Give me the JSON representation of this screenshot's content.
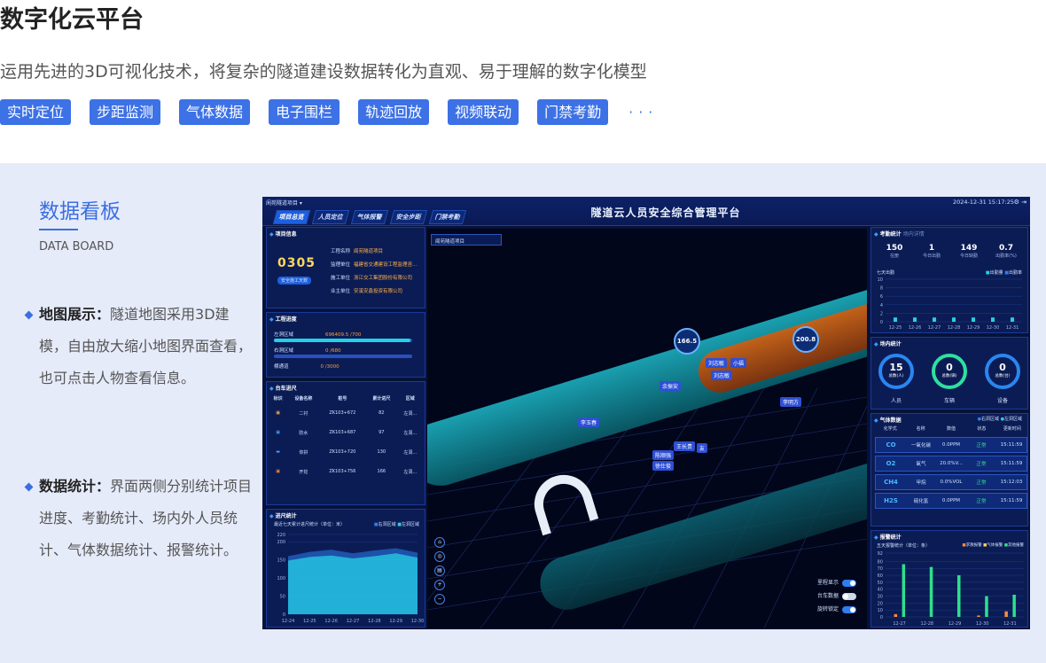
{
  "hero": {
    "title": "数字化云平台",
    "subtitle": "运用先进的3D可视化技术，将复杂的隧道建设数据转化为直观、易于理解的数字化模型",
    "tags": [
      "实时定位",
      "步距监测",
      "气体数据",
      "电子围栏",
      "轨迹回放",
      "视频联动",
      "门禁考勤"
    ],
    "more": "···"
  },
  "board": {
    "title": "数据看板",
    "subtitle": "DATA BOARD",
    "features": [
      {
        "label": "地图展示：",
        "text": "隧道地图采用3D建模，自由放大缩小地图界面查看，也可点击人物查看信息。"
      },
      {
        "label": "数据统计：",
        "text": "界面两侧分别统计项目进度、考勤统计、场内外人员统计、气体数据统计、报警统计。"
      }
    ]
  },
  "dash": {
    "project_selector": "阆苑隧道项目 ▾",
    "datetime": "2024-12-31 15:17:25",
    "title": "隧道云人员安全综合管理平台",
    "nav": [
      "项目总览",
      "人员定位",
      "气体报警",
      "安全步距",
      "门禁考勤"
    ],
    "project_info": {
      "header": "项目信息",
      "days": "0305",
      "days_label": "安全施工天数",
      "rows": [
        {
          "k": "工程名称",
          "v": "阆苑隧道项目"
        },
        {
          "k": "监理单位",
          "v": "福建省交通建设工程监理咨..."
        },
        {
          "k": "施工单位",
          "v": "浙江交工集团股份有限公司"
        },
        {
          "k": "业主单位",
          "v": "安溪安鑫投资有限公司"
        }
      ]
    },
    "progress": {
      "header": "工程进度",
      "rows": [
        {
          "name": "左洞区域",
          "value": "696409.5 /700",
          "fraction": 0.99
        },
        {
          "name": "右洞区域",
          "value": "0 /680",
          "fraction": 0
        },
        {
          "name": "横通道",
          "value": "0 /3000",
          "fraction": 0
        }
      ]
    },
    "trolley": {
      "header": "台车进尺",
      "columns": [
        "标识",
        "设备名称",
        "桩号",
        "累计进尺",
        "区域"
      ],
      "rows": [
        [
          "",
          "二衬",
          "ZK103+672",
          "82",
          "左洞..."
        ],
        [
          "",
          "防水",
          "ZK103+687",
          "97",
          "左洞..."
        ],
        [
          "",
          "仰拱",
          "ZK103+720",
          "130",
          "左洞..."
        ],
        [
          "",
          "开挖",
          "ZK103+756",
          "166",
          "左洞..."
        ]
      ]
    },
    "footage": {
      "header": "进尺统计",
      "caption": "最近七天累计进尺统计（单位：米）",
      "legend": [
        "右洞区域",
        "左洞区域"
      ],
      "chart_data": {
        "type": "area",
        "categories": [
          "12-24",
          "12-25",
          "12-26",
          "12-27",
          "12-28",
          "12-29",
          "12-30"
        ],
        "series": [
          {
            "name": "左洞区域",
            "values": [
              160,
              172,
              178,
              168,
              176,
              182,
              170
            ]
          },
          {
            "name": "右洞区域",
            "values": [
              148,
              158,
              162,
              154,
              160,
              168,
              156
            ]
          }
        ],
        "yticks": [
          0,
          50,
          100,
          150,
          200,
          220
        ],
        "ylim": [
          0,
          220
        ]
      }
    },
    "viewport": {
      "selector": "阆苑隧道项目",
      "bubbles": [
        "166.5",
        "200.8"
      ],
      "people": [
        "刘志敏",
        "小福",
        "刘志敏",
        "余振安",
        "李玉春",
        "李明方",
        "王长贵",
        "陈顺强",
        "徐仕俊",
        "友"
      ],
      "toggles": [
        {
          "label": "里程显示",
          "on": true
        },
        {
          "label": "台车数据",
          "on": false
        },
        {
          "label": "旋转锁定",
          "on": true
        }
      ],
      "controls": [
        "⌂",
        "◎",
        "▤",
        "+",
        "−"
      ]
    },
    "attendance": {
      "header": "考勤统计",
      "tab2": "场内详情",
      "stats": [
        {
          "value": "150",
          "label": "在册"
        },
        {
          "value": "1",
          "label": "今日出勤"
        },
        {
          "value": "149",
          "label": "今日缺勤"
        },
        {
          "value": "0.7",
          "label": "出勤率(%)"
        }
      ],
      "chart_label": "七天出勤",
      "legend": [
        "出勤量",
        "出勤率"
      ],
      "chart_data": {
        "type": "bar",
        "categories": [
          "12-25",
          "12-26",
          "12-27",
          "12-28",
          "12-29",
          "12-30",
          "12-31"
        ],
        "values": [
          1,
          1,
          1,
          1,
          1,
          1,
          1
        ],
        "yticks": [
          0,
          2,
          4,
          6,
          8,
          10
        ],
        "ylim": [
          0,
          10
        ]
      }
    },
    "onsite": {
      "header": "场内统计",
      "rings": [
        {
          "value": "15",
          "sub": "总数(人)",
          "label": "人员"
        },
        {
          "value": "0",
          "sub": "总数(辆)",
          "label": "车辆"
        },
        {
          "value": "0",
          "sub": "总数(台)",
          "label": "设备"
        }
      ]
    },
    "gas": {
      "header": "气体数据",
      "legend": [
        "右洞区域",
        "左洞区域"
      ],
      "columns": [
        "化学式",
        "名称",
        "数值",
        "状态",
        "更新时间"
      ],
      "rows": [
        {
          "code": "CO",
          "name": "一氧化碳",
          "value": "0.0PPM",
          "status": "正常",
          "time": "15:11:59"
        },
        {
          "code": "O2",
          "name": "氧气",
          "value": "20.0%V...",
          "status": "正常",
          "time": "15:11:59"
        },
        {
          "code": "CH4",
          "name": "甲烷",
          "value": "0.0%VOL",
          "status": "正常",
          "time": "15:12:03"
        },
        {
          "code": "H2S",
          "name": "硫化氢",
          "value": "0.0PPM",
          "status": "正常",
          "time": "15:11:59"
        }
      ]
    },
    "alarm": {
      "header": "报警统计",
      "caption": "五天报警统计（单位：条）",
      "legend": [
        "求救报警",
        "气体报警",
        "其他报警"
      ],
      "chart_data": {
        "type": "bar",
        "categories": [
          "12-27",
          "12-28",
          "12-29",
          "12-30",
          "12-31"
        ],
        "series": [
          {
            "name": "求救报警",
            "values": [
              4,
              0,
              0,
              2,
              8
            ]
          },
          {
            "name": "气体报警",
            "values": [
              0,
              0,
              0,
              0,
              0
            ]
          },
          {
            "name": "其他报警",
            "values": [
              76,
              72,
              60,
              30,
              32
            ]
          }
        ],
        "yticks": [
          0,
          10,
          20,
          30,
          40,
          50,
          60,
          70,
          80,
          92
        ],
        "ylim": [
          0,
          92
        ],
        "colors": [
          "#ff8a3b",
          "#ffd75a",
          "#2ee08c"
        ]
      }
    }
  }
}
